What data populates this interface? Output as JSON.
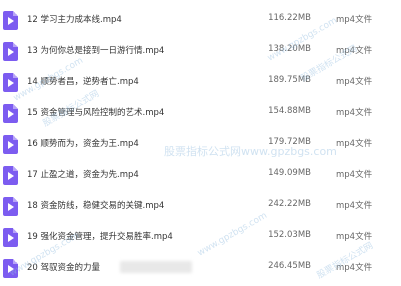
{
  "files": [
    {
      "name": "12 学习主力成本线.mp4",
      "size": "116.22MB",
      "type": "mp4文件"
    },
    {
      "name": "13 为何你总是接到一日游行情.mp4",
      "size": "138.20MB",
      "type": "mp4文件"
    },
    {
      "name": "14 顺势者昌，逆势者亡.mp4",
      "size": "189.75MB",
      "type": "mp4文件"
    },
    {
      "name": "15 资金管理与风险控制的艺术.mp4",
      "size": "154.88MB",
      "type": "mp4文件"
    },
    {
      "name": "16 顺势而为，资金为王.mp4",
      "size": "179.72MB",
      "type": "mp4文件"
    },
    {
      "name": "17 止盈之道，资金为先.mp4",
      "size": "149.09MB",
      "type": "mp4文件"
    },
    {
      "name": "18 资金防线，稳健交易的关键.mp4",
      "size": "242.22MB",
      "type": "mp4文件"
    },
    {
      "name": "19 强化资金管理，提升交易胜率.mp4",
      "size": "152.03MB",
      "type": "mp4文件"
    },
    {
      "name": "20 驾驭资金的力量",
      "size": "246.45MB",
      "type": "mp4文件"
    }
  ],
  "watermarks": {
    "main": "股票指标公式网www.gpzbgs.com",
    "url": "www.gpzbgs.com",
    "cn": "股票指标公式网"
  },
  "colors": {
    "file_icon": "#7c5cf0",
    "watermark": "#96bee1"
  }
}
